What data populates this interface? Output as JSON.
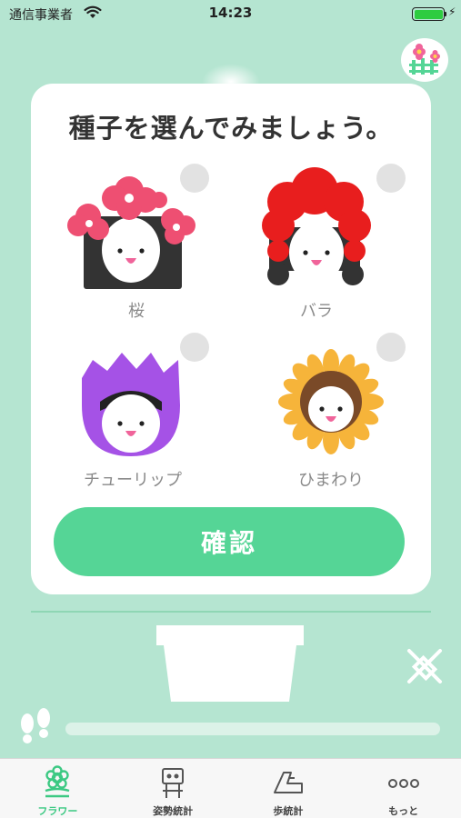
{
  "status_bar": {
    "carrier": "通信事業者",
    "time": "14:23",
    "battery_level": 1.0
  },
  "dialog": {
    "title": "種子を選んでみましょう。",
    "options": [
      {
        "label": "桜",
        "icon": "sakura-flower-character",
        "checked": false
      },
      {
        "label": "バラ",
        "icon": "rose-flower-character",
        "checked": false
      },
      {
        "label": "チューリップ",
        "icon": "tulip-flower-character",
        "checked": false
      },
      {
        "label": "ひまわり",
        "icon": "sunflower-flower-character",
        "checked": false
      }
    ],
    "confirm_label": "確認"
  },
  "step_progress": 0,
  "tabs": [
    {
      "label": "フラワー",
      "icon": "flower-icon",
      "active": true
    },
    {
      "label": "姿勢統計",
      "icon": "posture-stats-icon",
      "active": false
    },
    {
      "label": "歩統計",
      "icon": "step-stats-icon",
      "active": false
    },
    {
      "label": "もっと",
      "icon": "more-icon",
      "active": false
    }
  ],
  "colors": {
    "background": "#b5e5d1",
    "accent": "#55d596",
    "active_tab": "#3cc983"
  }
}
